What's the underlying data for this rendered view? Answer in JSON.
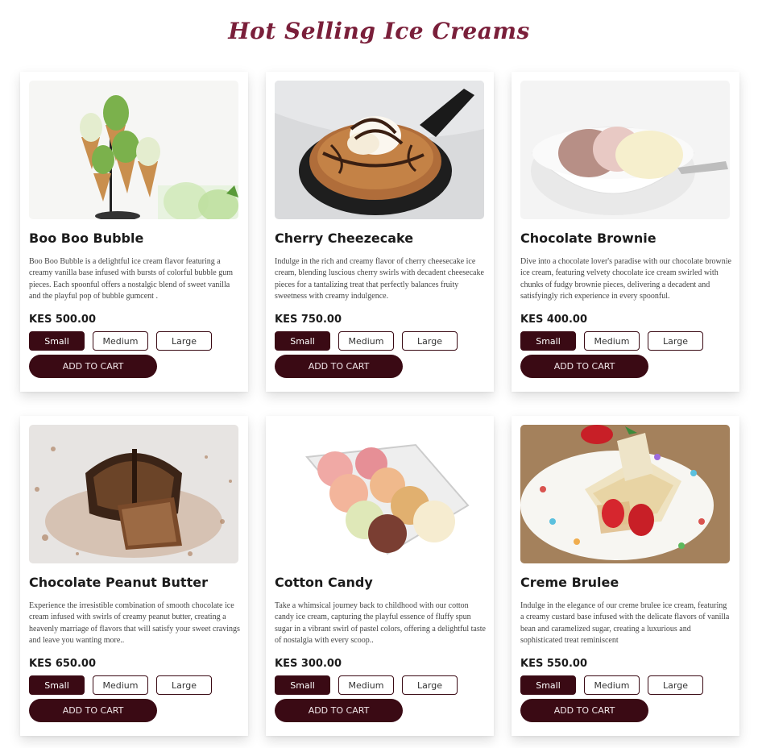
{
  "page": {
    "title": "Hot Selling Ice Creams"
  },
  "products": [
    {
      "name": "Boo Boo Bubble",
      "image_icon": "ice-cream-cones-image",
      "description": "Boo Boo Bubble is a delightful ice cream flavor featuring a creamy vanilla base infused with bursts of colorful bubble gum pieces. Each spoonful offers a nostalgic blend of sweet vanilla and the playful pop of bubble gumcent .",
      "price": "KES 500.00",
      "sizes": [
        "Small",
        "Medium",
        "Large"
      ],
      "selected_size": "Small",
      "cart_label": "ADD TO CART"
    },
    {
      "name": "Cherry Cheezecake",
      "image_icon": "skillet-cookie-sundae-image",
      "description": "Indulge in the rich and creamy flavor of cherry cheesecake ice cream, blending luscious cherry swirls with decadent cheesecake pieces for a tantalizing treat that perfectly balances fruity sweetness with creamy indulgence.",
      "price": "KES 750.00",
      "sizes": [
        "Small",
        "Medium",
        "Large"
      ],
      "selected_size": "Small",
      "cart_label": "ADD TO CART"
    },
    {
      "name": "Chocolate Brownie",
      "image_icon": "ice-cream-bowl-image",
      "description": "Dive into a chocolate lover's paradise with our chocolate brownie ice cream, featuring velvety chocolate ice cream swirled with chunks of fudgy brownie pieces, delivering a decadent and satisfyingly rich experience in every spoonful.",
      "price": "KES 400.00",
      "sizes": [
        "Small",
        "Medium",
        "Large"
      ],
      "selected_size": "Small",
      "cart_label": "ADD TO CART"
    },
    {
      "name": "Chocolate Peanut Butter",
      "image_icon": "chocolate-dessert-image",
      "description": "Experience the irresistible combination of smooth chocolate ice cream infused with swirls of creamy peanut butter, creating a heavenly marriage of flavors that will satisfy your sweet cravings and leave you wanting more..",
      "price": "KES 650.00",
      "sizes": [
        "Small",
        "Medium",
        "Large"
      ],
      "selected_size": "Small",
      "cart_label": "ADD TO CART"
    },
    {
      "name": "Cotton Candy",
      "image_icon": "ice-cream-scoops-tray-image",
      "description": "Take a whimsical journey back to childhood with our cotton candy ice cream, capturing the playful essence of fluffy spun sugar in a vibrant swirl of pastel colors, offering a delightful taste of nostalgia with every scoop..",
      "price": "KES 300.00",
      "sizes": [
        "Small",
        "Medium",
        "Large"
      ],
      "selected_size": "Small",
      "cart_label": "ADD TO CART"
    },
    {
      "name": "Creme Brulee",
      "image_icon": "dessert-plate-strawberries-image",
      "description": "Indulge in the elegance of our creme brulee ice cream, featuring a creamy custard base infused with the delicate flavors of vanilla bean and caramelized sugar, creating a luxurious and sophisticated treat reminiscent",
      "price": "KES 550.00",
      "sizes": [
        "Small",
        "Medium",
        "Large"
      ],
      "selected_size": "Small",
      "cart_label": "ADD TO CART"
    }
  ],
  "colors": {
    "brand": "#3a0a14",
    "title": "#7a1f3a"
  }
}
